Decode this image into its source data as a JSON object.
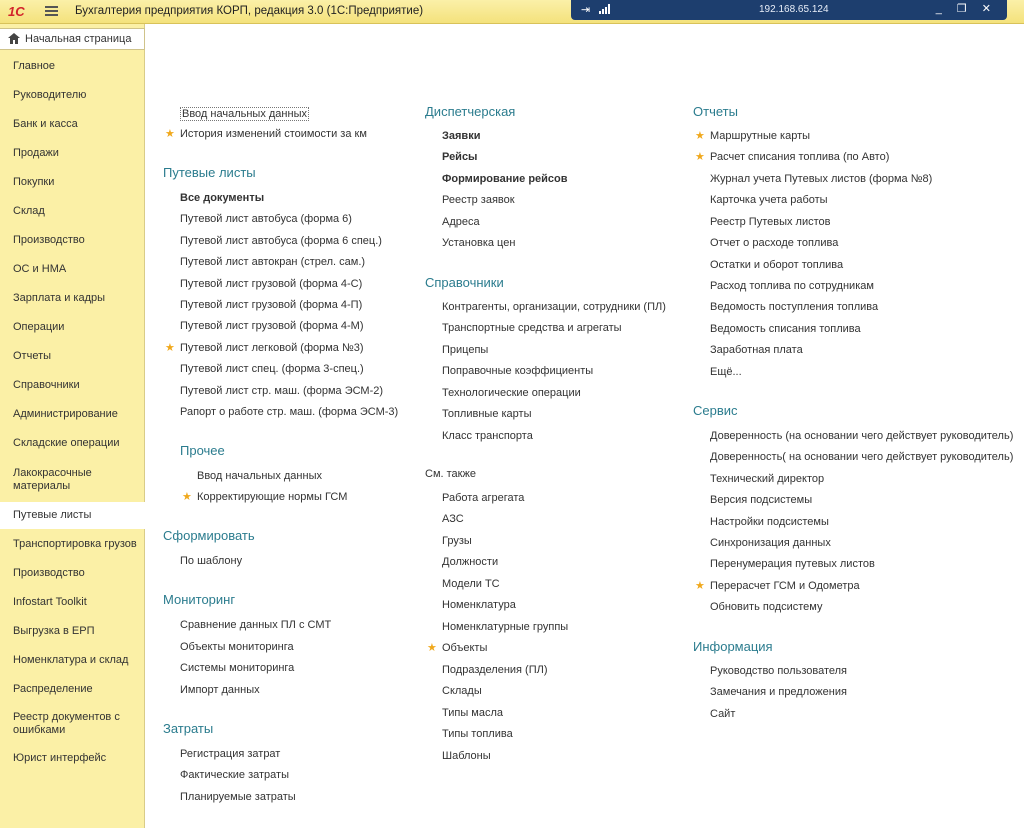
{
  "titlebar": {
    "logo": "1С",
    "title": "Бухгалтерия предприятия КОРП, редакция 3.0  (1С:Предприятие)",
    "remote_ip": "192.168.65.124",
    "window_buttons": "_ ❐ ✕"
  },
  "sidebar": {
    "home": "Начальная страница",
    "items": [
      {
        "label": "Главное"
      },
      {
        "label": "Руководителю"
      },
      {
        "label": "Банк и касса"
      },
      {
        "label": "Продажи"
      },
      {
        "label": "Покупки"
      },
      {
        "label": "Склад"
      },
      {
        "label": "Производство"
      },
      {
        "label": "ОС и НМА"
      },
      {
        "label": "Зарплата и кадры"
      },
      {
        "label": "Операции"
      },
      {
        "label": "Отчеты"
      },
      {
        "label": "Справочники"
      },
      {
        "label": "Администрирование"
      },
      {
        "label": "Складские операции"
      },
      {
        "label": "Лакокрасочные материалы"
      },
      {
        "label": "Путевые листы"
      },
      {
        "label": "Транспортировка грузов"
      },
      {
        "label": "Производство"
      },
      {
        "label": "Infostart Toolkit"
      },
      {
        "label": "Выгрузка в ЕРП"
      },
      {
        "label": "Номенклатура и склад"
      },
      {
        "label": "Распределение"
      },
      {
        "label": "Реестр документов с ошибками"
      },
      {
        "label": "Юрист интерфейс"
      }
    ]
  },
  "col1": {
    "top_links": [
      "Ввод начальных данных",
      "История изменений стоимости за км"
    ],
    "putevye": {
      "title": "Путевые листы",
      "items": [
        "Все документы",
        "Путевой лист автобуса (форма 6)",
        "Путевой лист автобуса (форма 6 спец.)",
        "Путевой лист автокран (стрел. сам.)",
        "Путевой лист грузовой (форма 4-С)",
        "Путевой лист грузовой (форма 4-П)",
        "Путевой лист грузовой (форма 4-М)",
        "Путевой лист легковой (форма №3)",
        "Путевой лист спец. (форма 3-спец.)",
        "Путевой лист стр. маш. (форма ЭСМ-2)",
        "Рапорт о работе стр. маш. (форма ЭСМ-3)"
      ]
    },
    "prochee": {
      "title": "Прочее",
      "items": [
        "Ввод начальных данных",
        "Корректирующие нормы ГСМ"
      ]
    },
    "sformirovat": {
      "title": "Сформировать",
      "items": [
        "По шаблону"
      ]
    },
    "monitoring": {
      "title": "Мониторинг",
      "items": [
        "Сравнение данных ПЛ с СМТ",
        "Объекты мониторинга",
        "Системы мониторинга",
        "Импорт данных"
      ]
    },
    "zatraty": {
      "title": "Затраты",
      "items": [
        "Регистрация затрат",
        "Фактические затраты",
        "Планируемые затраты"
      ]
    }
  },
  "col2": {
    "dispatch": {
      "title": "Диспетчерская",
      "items": [
        "Заявки",
        "Рейсы",
        "Формирование рейсов",
        "Реестр заявок",
        "Адреса",
        "Установка цен"
      ]
    },
    "spravochniki": {
      "title": "Справочники",
      "items": [
        "Контрагенты, организации, сотрудники (ПЛ)",
        "Транспортные средства и агрегаты",
        "Прицепы",
        "Поправочные коэффициенты",
        "Технологические операции",
        "Топливные карты",
        "Класс транспорта"
      ]
    },
    "see_also": {
      "title": "См. также",
      "items": [
        "Работа агрегата",
        "АЗС",
        "Грузы",
        "Должности",
        "Модели ТС",
        "Номенклатура",
        "Номенклатурные группы",
        "Объекты",
        "Подразделения (ПЛ)",
        "Склады",
        "Типы масла",
        "Типы топлива",
        "Шаблоны"
      ]
    }
  },
  "col3": {
    "otchety": {
      "title": "Отчеты",
      "items": [
        "Маршрутные карты",
        "Расчет списания топлива (по Авто)",
        "Журнал учета Путевых листов (форма №8)",
        "Карточка учета работы",
        "Реестр Путевых листов",
        "Отчет о расходе топлива",
        "Остатки и оборот топлива",
        "Расход топлива по сотрудникам",
        "Ведомость поступления топлива",
        "Ведомость списания топлива",
        "Заработная плата",
        "Ещё..."
      ]
    },
    "servis": {
      "title": "Сервис",
      "items": [
        "Доверенность (на основании чего действует руководитель)",
        "Доверенность( на основании чего действует руководитель)",
        "Технический директор",
        "Версия подсистемы",
        "Настройки подсистемы",
        "Синхронизация данных",
        "Перенумерация путевых листов",
        "Перерасчет ГСМ и Одометра",
        "Обновить подсистему"
      ]
    },
    "info": {
      "title": "Информация",
      "items": [
        "Руководство пользователя",
        "Замечания и предложения",
        "Сайт"
      ]
    }
  },
  "colors": {
    "accent": "#2b7c8e",
    "sidebar_bg": "#fbf0a6",
    "star": "#f0a81c",
    "remote_bar": "#1d3e6e"
  }
}
